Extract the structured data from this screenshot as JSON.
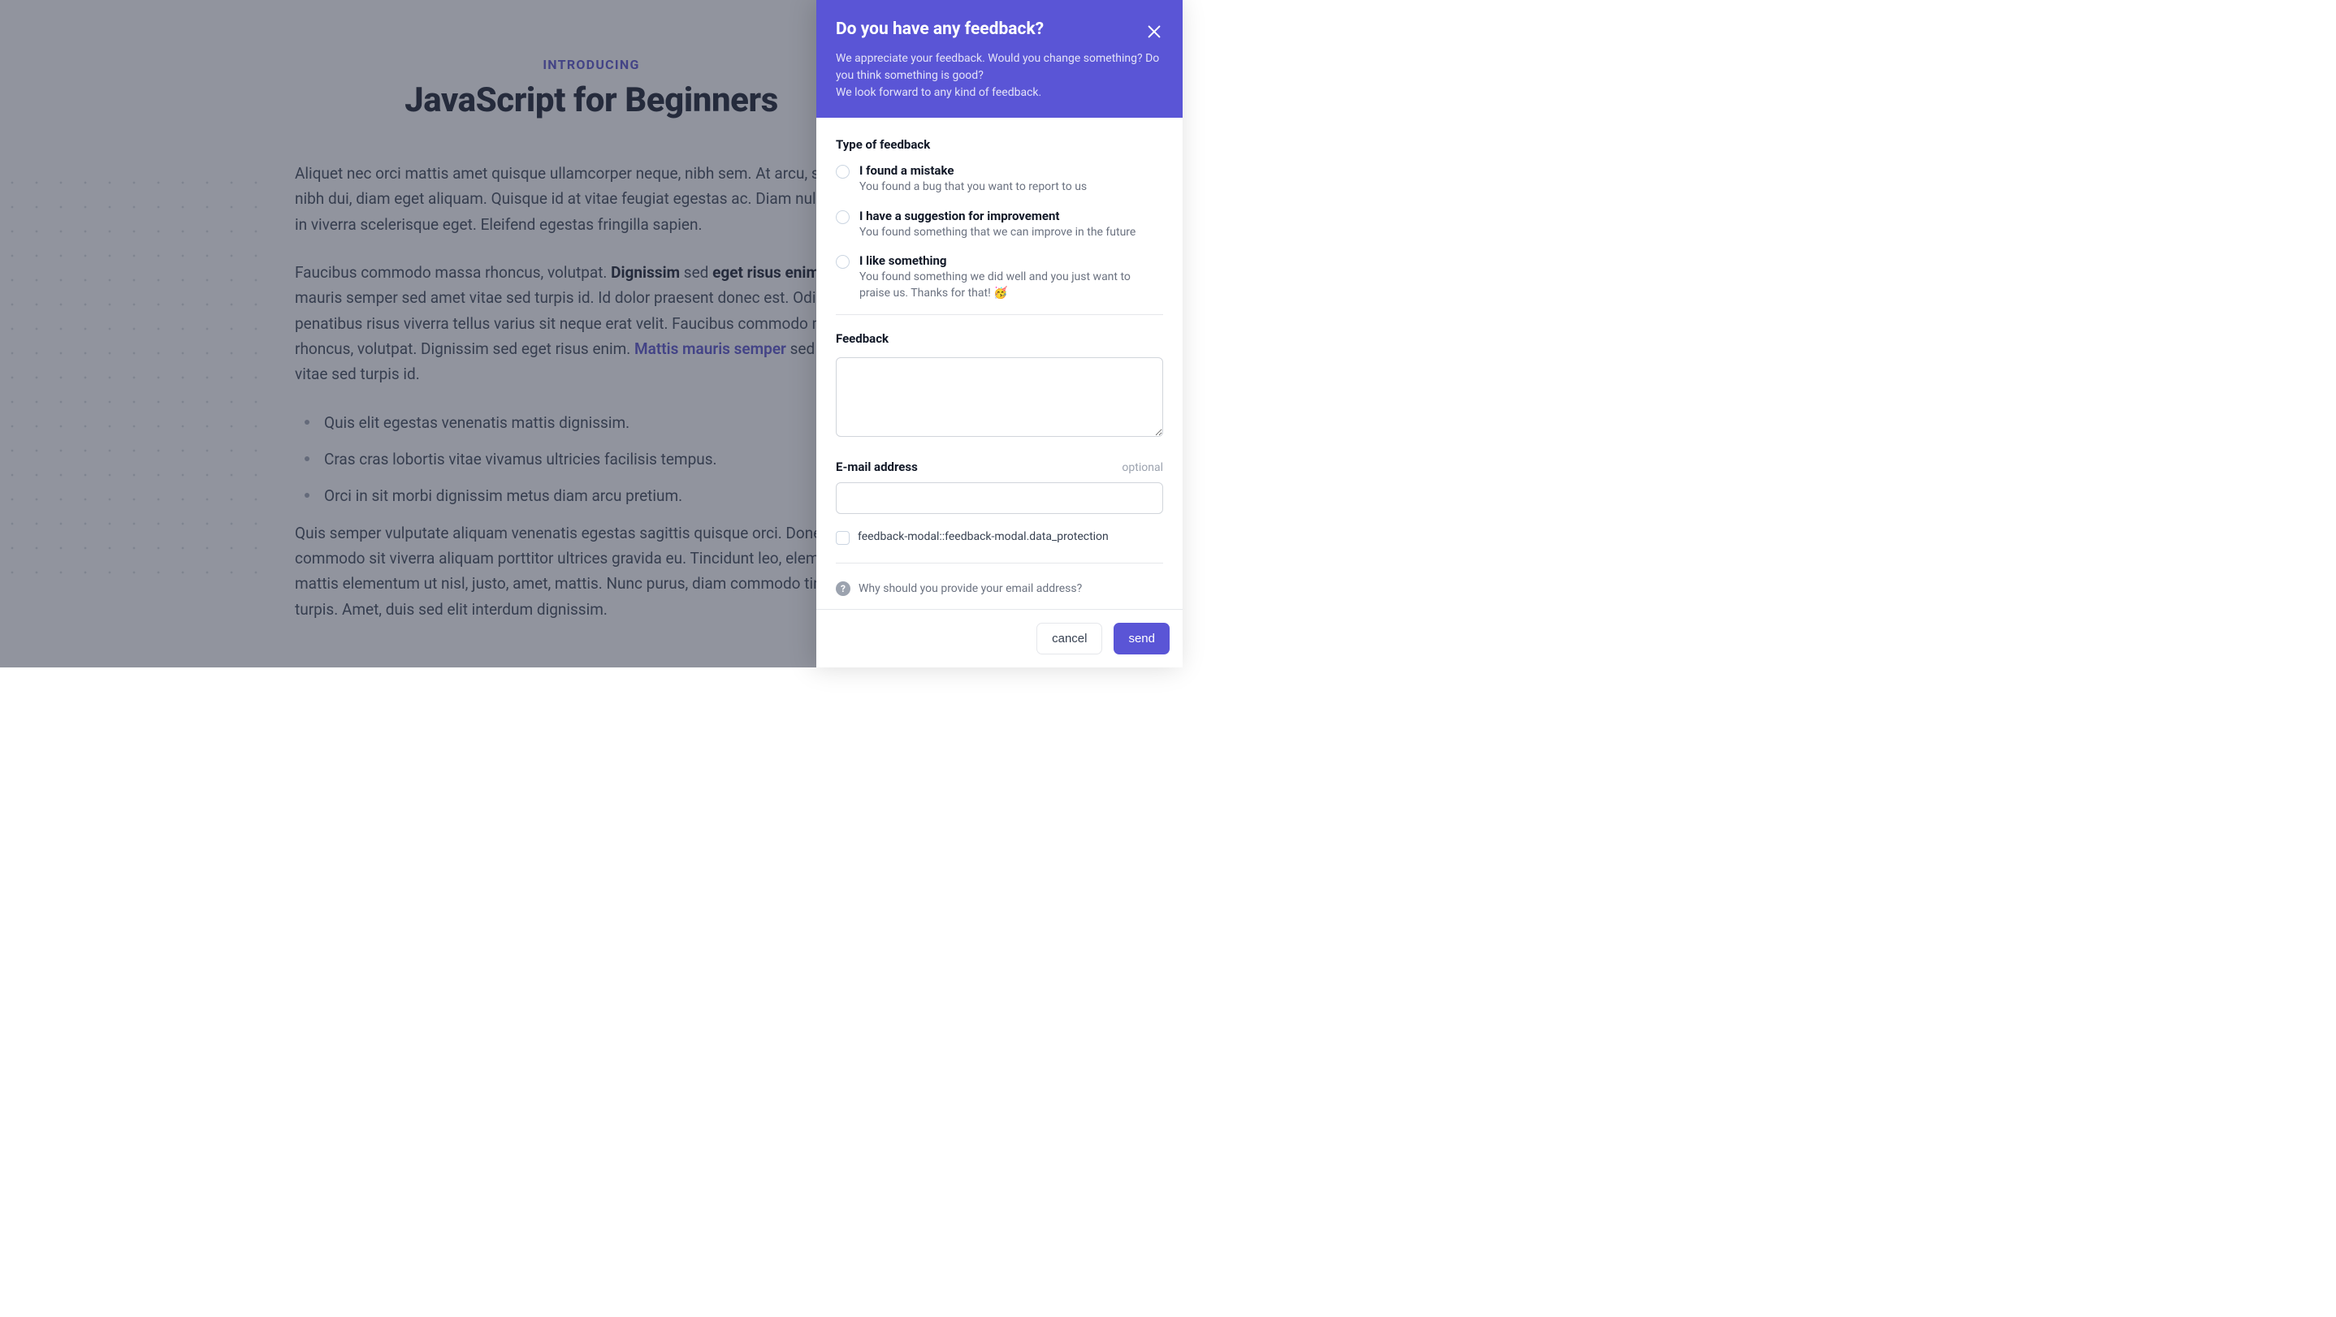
{
  "page": {
    "kicker": "INTRODUCING",
    "headline": "JavaScript for Beginners",
    "para1": "Aliquet nec orci mattis amet quisque ullamcorper neque, nibh sem. At arcu, sit dui mi, nibh dui, diam eget aliquam. Quisque id at vitae feugiat egestas ac. Diam nulla orci at in viverra scelerisque eget. Eleifend egestas fringilla sapien.",
    "para2_a": "Faucibus commodo massa rhoncus, volutpat. ",
    "para2_strong1": "Dignissim",
    "para2_b": " sed ",
    "para2_strong2": "eget risus enim",
    "para2_c": ". Mattis mauris semper sed amet vitae sed turpis id. Id dolor praesent donec est. Odio penatibus risus viverra tellus varius sit neque erat velit. Faucibus commodo massa rhoncus, volutpat. Dignissim sed eget risus enim. ",
    "para2_link": "Mattis mauris semper",
    "para2_d": " sed amet vitae sed turpis id.",
    "bullets": [
      "Quis elit egestas venenatis mattis dignissim.",
      "Cras cras lobortis vitae vivamus ultricies facilisis tempus.",
      "Orci in sit morbi dignissim metus diam arcu pretium."
    ],
    "para3": "Quis semper vulputate aliquam venenatis egestas sagittis quisque orci. Donec commodo sit viverra aliquam porttitor ultrices gravida eu. Tincidunt leo, elementum mattis elementum ut nisl, justo, amet, mattis. Nunc purus, diam commodo tincidunt turpis. Amet, duis sed elit interdum dignissim."
  },
  "panel": {
    "title": "Do you have any feedback?",
    "sub1": "We appreciate your feedback. Would you change something? Do you think something is good?",
    "sub2": "We look forward to any kind of feedback.",
    "type_label": "Type of feedback",
    "options": [
      {
        "title": "I found a mistake",
        "desc": "You found a bug that you want to report to us"
      },
      {
        "title": "I have a suggestion for improvement",
        "desc": "You found something that we can improve in the future"
      },
      {
        "title": "I like something",
        "desc": "You found something we did well and you just want to praise us. Thanks for that! 🥳"
      }
    ],
    "feedback_label": "Feedback",
    "email_label": "E-mail address",
    "optional": "optional",
    "data_protection": "feedback-modal::feedback-modal.data_protection",
    "info": "Why should you provide your email address?",
    "cancel": "cancel",
    "send": "send"
  }
}
